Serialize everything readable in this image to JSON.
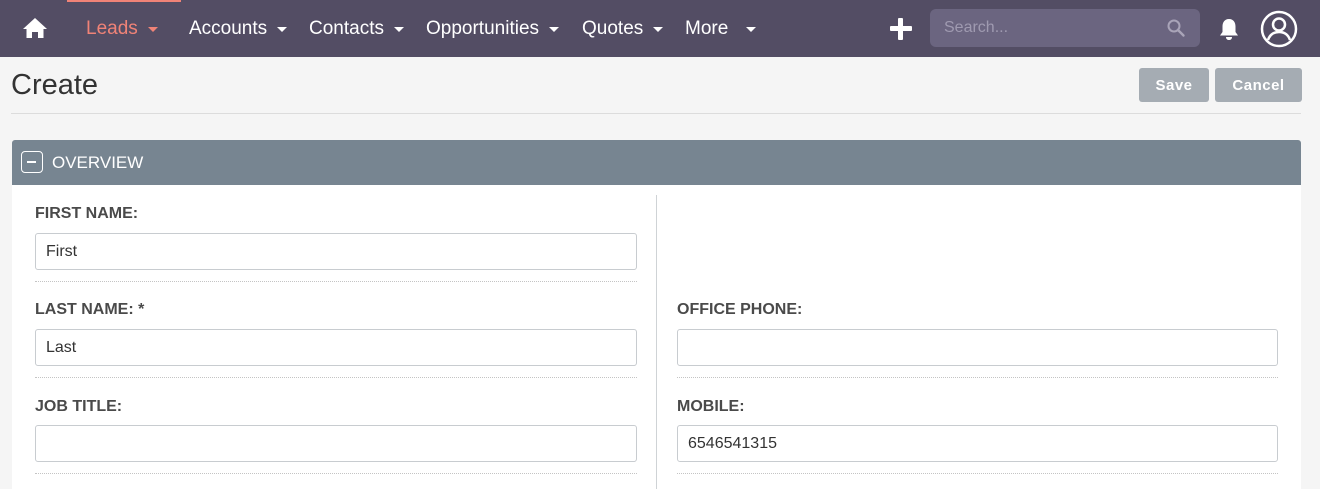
{
  "nav": {
    "items": [
      {
        "label": "Leads",
        "active": true
      },
      {
        "label": "Accounts",
        "active": false
      },
      {
        "label": "Contacts",
        "active": false
      },
      {
        "label": "Opportunities",
        "active": false
      },
      {
        "label": "Quotes",
        "active": false
      },
      {
        "label": "More",
        "active": false
      }
    ],
    "search_placeholder": "Search...",
    "icons": {
      "home": "home-icon",
      "create": "plus-icon",
      "search": "search-icon",
      "notifications": "bell-icon",
      "user": "user-avatar-icon"
    }
  },
  "page": {
    "title": "Create",
    "save_label": "Save",
    "cancel_label": "Cancel"
  },
  "panel": {
    "title": "OVERVIEW",
    "collapse_icon": "minus-icon"
  },
  "fields": {
    "first_name": {
      "label": "FIRST NAME:",
      "value": "First"
    },
    "last_name": {
      "label": "LAST NAME: *",
      "value": "Last"
    },
    "job_title": {
      "label": "JOB TITLE:",
      "value": ""
    },
    "office_phone": {
      "label": "OFFICE PHONE:",
      "value": ""
    },
    "mobile": {
      "label": "MOBILE:",
      "value": "6546541315"
    }
  },
  "colors": {
    "nav_bg": "#534d64",
    "accent": "#f08377",
    "panel_header": "#778591",
    "button": "#a5acb3"
  }
}
